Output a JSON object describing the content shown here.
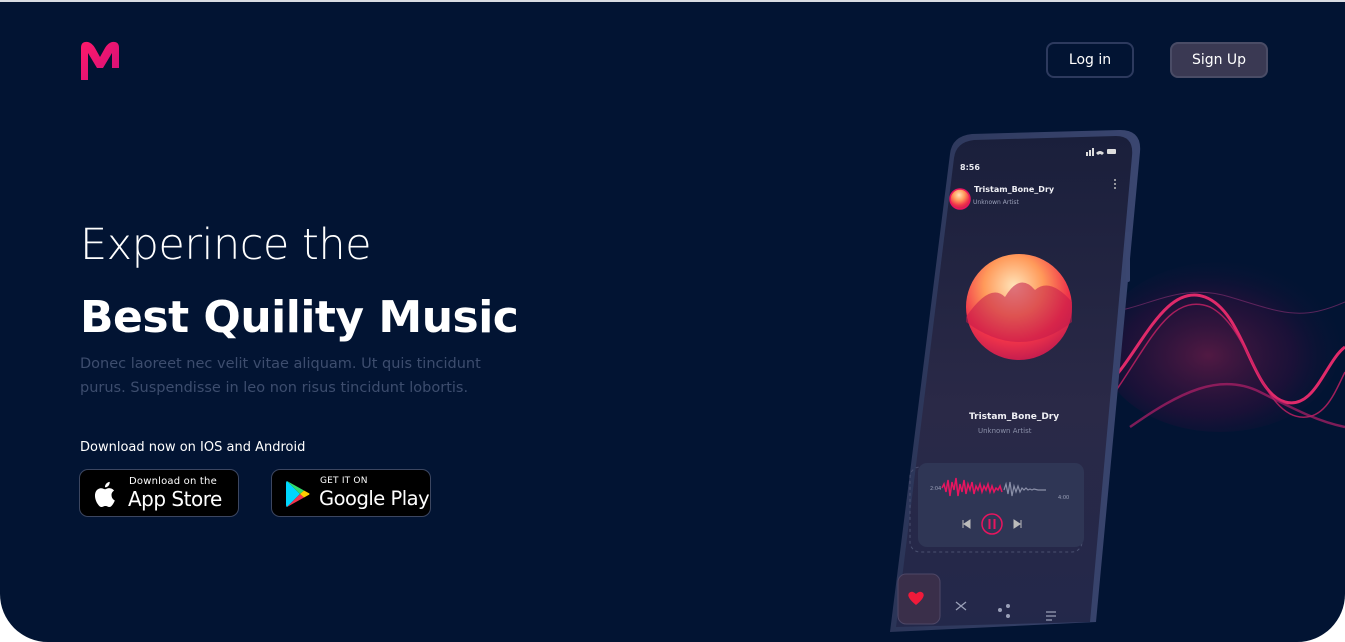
{
  "header": {
    "login_label": "Log in",
    "signup_label": "Sign Up"
  },
  "hero": {
    "title_line1": "Experince the",
    "title_line2": "Best Quility Music",
    "description": "Donec laoreet nec velit vitae aliquam. Ut quis tincidunt purus. Suspendisse in leo non risus tincidunt lobortis.",
    "download_label": "Download now on IOS and Android"
  },
  "stores": {
    "apple_small": "Download on the",
    "apple_big": "App Store",
    "google_small": "GET IT ON",
    "google_big": "Google Play"
  },
  "phone": {
    "time": "8:56",
    "track_title": "Tristam_Bone_Dry",
    "track_artist": "Unknown Artist",
    "main_title": "Tristam_Bone_Dry",
    "main_artist": "Unknown Artist",
    "elapsed": "2:04",
    "total": "4:00"
  },
  "colors": {
    "background": "#021433",
    "accent": "#e8155f",
    "logo_gradient": [
      "#ff1a6a",
      "#d20f7a"
    ]
  },
  "icons": [
    "m-logo-icon",
    "apple-icon",
    "google-play-icon",
    "heart-icon",
    "shuffle-icon",
    "share-icon",
    "playlist-icon",
    "pause-icon",
    "prev-icon",
    "next-icon",
    "signal-icon",
    "wifi-icon",
    "battery-icon",
    "more-icon"
  ]
}
